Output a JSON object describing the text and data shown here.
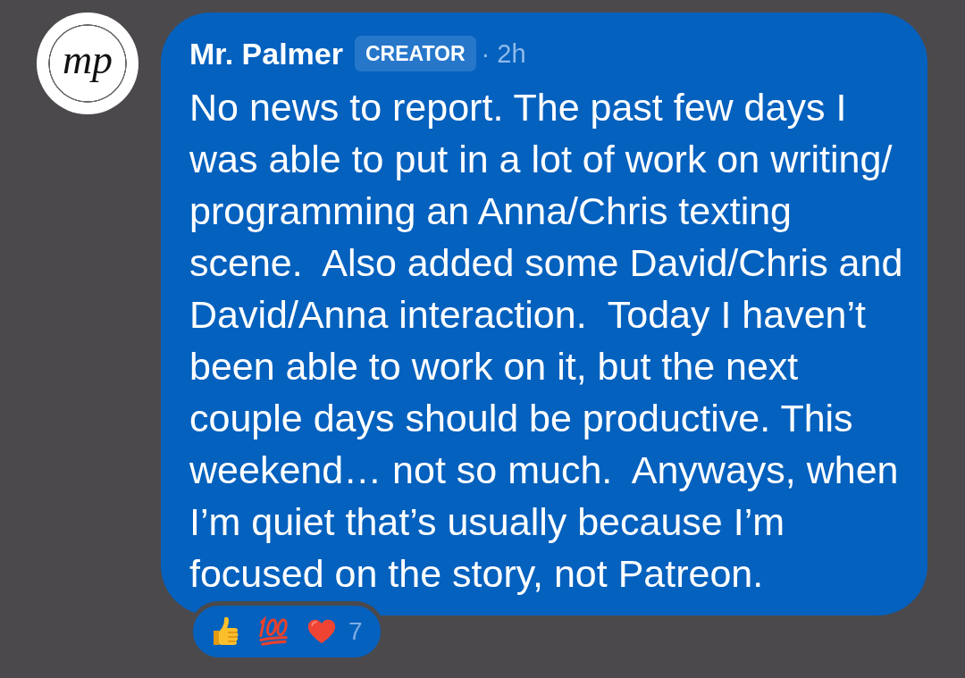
{
  "avatar": {
    "monogram": "mp"
  },
  "post": {
    "author": "Mr. Palmer",
    "badge": "CREATOR",
    "time": "· 2h",
    "body": "No news to report. The past few days I was able to put in a lot of work on writing/programming an Anna/Chris texting scene.  Also added some David/Chris and David/Anna interaction.  Today I haven’t been able to work on it, but the next couple days should be productive. This weekend… not so much.  Anyways, when I’m quiet that’s usually because I’m focused on the story, not Patreon."
  },
  "reactions": {
    "count": "7"
  }
}
